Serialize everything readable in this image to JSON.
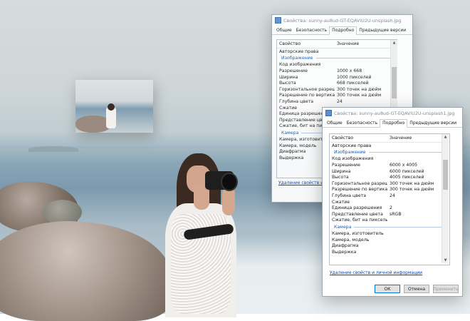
{
  "back_dialog": {
    "title": "Свойства: sunny-au8ud-GT-EQAVIU2U-unsplash.jpg",
    "tabs": [
      "Общие",
      "Безопасность",
      "Подробно",
      "Предыдущие версии"
    ],
    "active_tab": "Подробно",
    "columns": {
      "property": "Свойство",
      "value": "Значение"
    },
    "rows_top": [
      {
        "p": "Авторские права",
        "v": ""
      }
    ],
    "group_image": "Изображение",
    "rows_image": [
      {
        "p": "Код изображения",
        "v": ""
      },
      {
        "p": "Разрешение",
        "v": "1000 x 668"
      },
      {
        "p": "Ширина",
        "v": "1000 пикселей"
      },
      {
        "p": "Высота",
        "v": "668 пикселей"
      },
      {
        "p": "Горизонтальное разреше...",
        "v": "300 точек на дюйм"
      },
      {
        "p": "Разрешение по вертикали",
        "v": "300 точек на дюйм"
      },
      {
        "p": "Глубина цвета",
        "v": "24"
      },
      {
        "p": "Сжатие",
        "v": ""
      },
      {
        "p": "Единица разрешения",
        "v": ""
      },
      {
        "p": "Представление цвета",
        "v": ""
      },
      {
        "p": "Сжатие, бит на пиксель",
        "v": ""
      }
    ],
    "group_camera": "Камера",
    "rows_camera": [
      {
        "p": "Камера, изготовитель",
        "v": ""
      },
      {
        "p": "Камера, модель",
        "v": ""
      },
      {
        "p": "Диафрагма",
        "v": ""
      },
      {
        "p": "Выдержка",
        "v": ""
      }
    ],
    "link": "Удаление свойств и личной информации"
  },
  "front_dialog": {
    "title": "Свойства: sunny-au8ud-GT-EQAVIU2U-unsplash1.jpg",
    "tabs": [
      "Общие",
      "Безопасность",
      "Подробно",
      "Предыдущие версии"
    ],
    "active_tab": "Подробно",
    "columns": {
      "property": "Свойство",
      "value": "Значение"
    },
    "rows_top": [
      {
        "p": "Авторские права",
        "v": ""
      }
    ],
    "group_image": "Изображение",
    "rows_image": [
      {
        "p": "Код изображения",
        "v": ""
      },
      {
        "p": "Разрешение",
        "v": "6000 x 4005"
      },
      {
        "p": "Ширина",
        "v": "6000 пикселей"
      },
      {
        "p": "Высота",
        "v": "4005 пикселей"
      },
      {
        "p": "Горизонтальное разреше...",
        "v": "300 точек на дюйм"
      },
      {
        "p": "Разрешение по вертикали",
        "v": "300 точек на дюйм"
      },
      {
        "p": "Глубина цвета",
        "v": "24"
      },
      {
        "p": "Сжатие",
        "v": ""
      },
      {
        "p": "Единица разрешения",
        "v": "2"
      },
      {
        "p": "Представление цвета",
        "v": "sRGB"
      },
      {
        "p": "Сжатие, бит на пиксель",
        "v": ""
      }
    ],
    "group_camera": "Камера",
    "rows_camera": [
      {
        "p": "Камера, изготовитель",
        "v": ""
      },
      {
        "p": "Камера, модель",
        "v": ""
      },
      {
        "p": "Диафрагма",
        "v": ""
      },
      {
        "p": "Выдержка",
        "v": ""
      }
    ],
    "link": "Удаление свойств и личной информации",
    "buttons": {
      "ok": "ОК",
      "cancel": "Отмена",
      "apply": "Применить"
    }
  },
  "colors": {
    "accent": "#0078d7",
    "group_text": "#1f5cab",
    "link": "#0645ad"
  }
}
